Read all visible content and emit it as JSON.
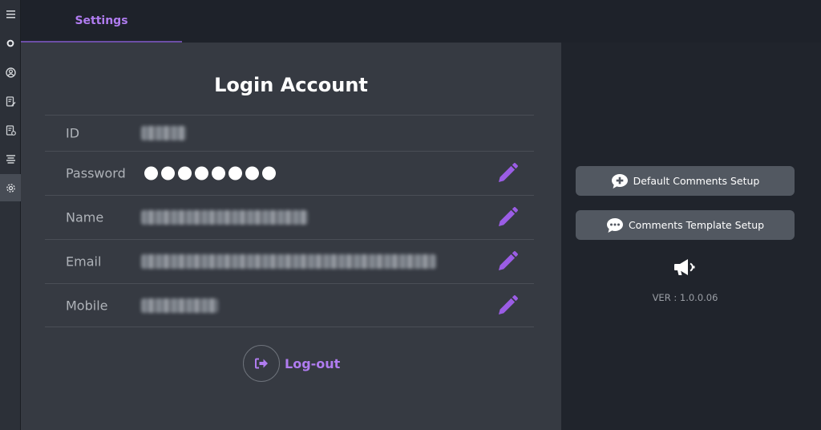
{
  "rail": {
    "items": [
      {
        "icon": "menu-icon",
        "active": false
      },
      {
        "icon": "circle-o-icon",
        "active": false
      },
      {
        "icon": "user-circle-icon",
        "active": false
      },
      {
        "icon": "edit-document-icon",
        "active": false
      },
      {
        "icon": "document-settings-icon",
        "active": false
      },
      {
        "icon": "layers-icon",
        "active": false
      },
      {
        "icon": "gear-icon",
        "active": true
      }
    ]
  },
  "header": {
    "tab_label": "Settings"
  },
  "account": {
    "title": "Login Account",
    "rows": [
      {
        "label": "ID",
        "value_redacted": true,
        "editable": false
      },
      {
        "label": "Password",
        "value_masked": "●●●●●●●●",
        "editable": true
      },
      {
        "label": "Name",
        "value_redacted": true,
        "editable": true
      },
      {
        "label": "Email",
        "value_redacted": true,
        "editable": true
      },
      {
        "label": "Mobile",
        "value_redacted": true,
        "editable": true
      }
    ],
    "logout_label": "Log-out"
  },
  "side": {
    "default_comments_label": "Default Comments Setup",
    "template_comments_label": "Comments Template Setup",
    "version": "VER : 1.0.0.06"
  },
  "colors": {
    "accent": "#b07cf0",
    "edit_icon": "#9b5de5",
    "panel": "#363a42",
    "background": "#20242c"
  }
}
